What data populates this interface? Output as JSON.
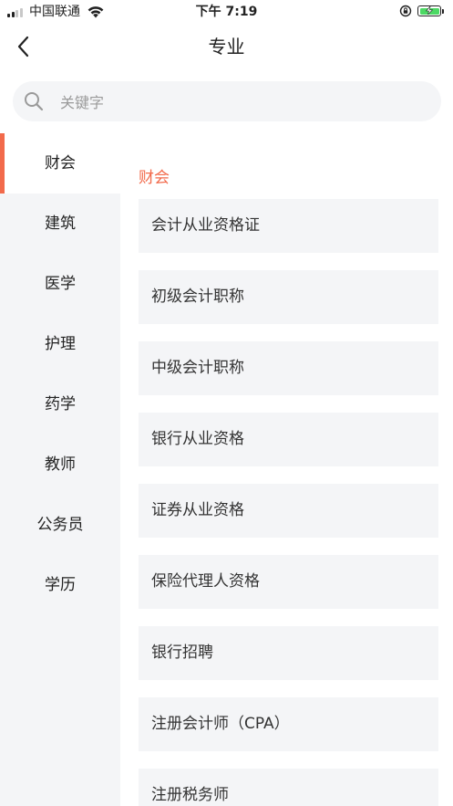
{
  "status_bar": {
    "carrier": "中国联通",
    "time": "下午 7:19"
  },
  "nav": {
    "title": "专业"
  },
  "search": {
    "placeholder": "关键字"
  },
  "sidebar": {
    "items": [
      {
        "label": "财会",
        "active": true
      },
      {
        "label": "建筑"
      },
      {
        "label": "医学"
      },
      {
        "label": "护理"
      },
      {
        "label": "药学"
      },
      {
        "label": "教师"
      },
      {
        "label": "公务员"
      },
      {
        "label": "学历"
      }
    ]
  },
  "content": {
    "section_title": "财会",
    "cards": [
      {
        "label": "会计从业资格证"
      },
      {
        "label": "初级会计职称"
      },
      {
        "label": "中级会计职称"
      },
      {
        "label": "银行从业资格"
      },
      {
        "label": "证券从业资格"
      },
      {
        "label": "保险代理人资格"
      },
      {
        "label": "银行招聘"
      },
      {
        "label": "注册会计师（CPA）"
      },
      {
        "label": "注册税务师"
      }
    ]
  },
  "colors": {
    "accent": "#f26a4b",
    "battery": "#4cd964",
    "card_bg": "#f4f5f7"
  }
}
